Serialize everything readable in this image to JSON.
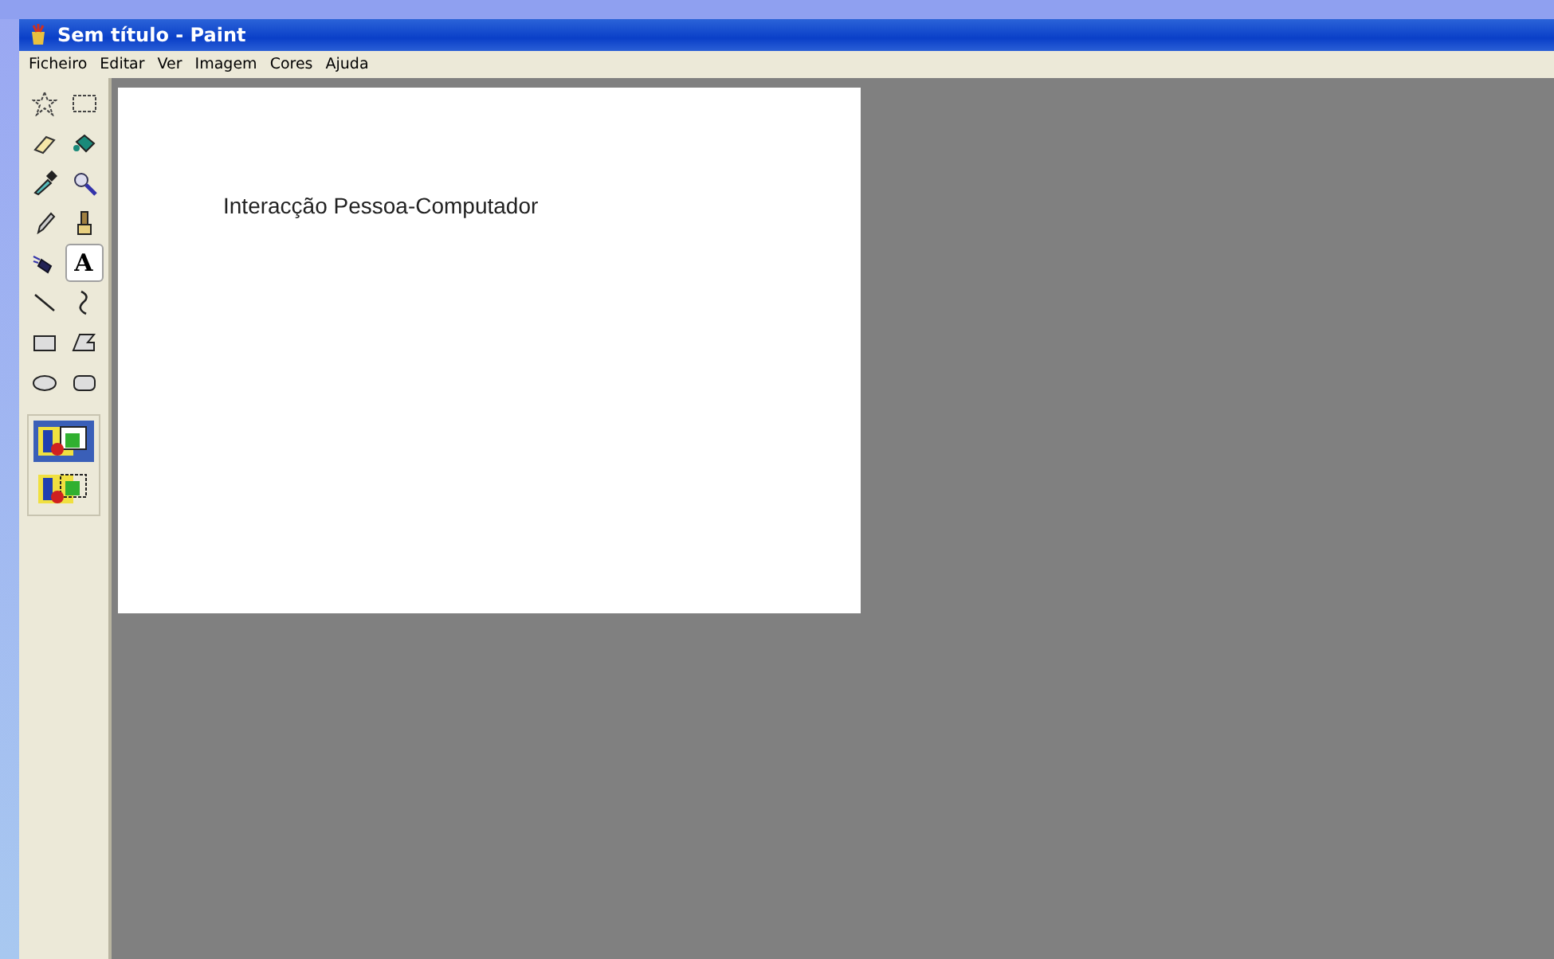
{
  "window": {
    "title": "Sem título - Paint"
  },
  "menu": [
    "Ficheiro",
    "Editar",
    "Ver",
    "Imagem",
    "Cores",
    "Ajuda"
  ],
  "tools": [
    {
      "kind": "free-select",
      "selected": false
    },
    {
      "kind": "select",
      "selected": false
    },
    {
      "kind": "eraser",
      "selected": false
    },
    {
      "kind": "fill",
      "selected": false
    },
    {
      "kind": "picker",
      "selected": false
    },
    {
      "kind": "magnifier",
      "selected": false
    },
    {
      "kind": "pencil",
      "selected": false
    },
    {
      "kind": "brush",
      "selected": false
    },
    {
      "kind": "airbrush",
      "selected": false
    },
    {
      "kind": "text",
      "label": "A",
      "selected": true
    },
    {
      "kind": "line",
      "selected": false
    },
    {
      "kind": "curve",
      "selected": false
    },
    {
      "kind": "rectangle",
      "selected": false
    },
    {
      "kind": "polygon",
      "selected": false
    },
    {
      "kind": "ellipse",
      "selected": false
    },
    {
      "kind": "rounded-rectangle",
      "selected": false
    }
  ],
  "transparency": [
    {
      "selected": true
    },
    {
      "selected": false
    }
  ],
  "canvas": {
    "text": "Interacção Pessoa-Computador"
  }
}
